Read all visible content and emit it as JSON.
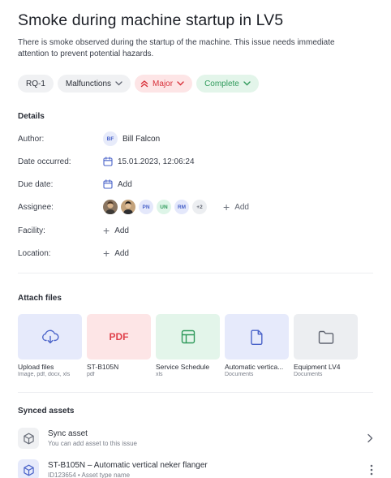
{
  "issue": {
    "title": "Smoke during machine startup in LV5",
    "description": "There is smoke observed during the startup of the machine. This issue needs immediate attention to prevent potential hazards."
  },
  "chips": {
    "id": "RQ-1",
    "category": "Malfunctions",
    "priority": "Major",
    "status": "Complete"
  },
  "colors": {
    "priority": "#d82f38",
    "status": "#2f9a5b",
    "accent": "#4a63c9"
  },
  "details": {
    "heading": "Details",
    "author_label": "Author:",
    "author_initials": "BF",
    "author_name": "Bill Falcon",
    "date_occurred_label": "Date occurred:",
    "date_occurred_value": "15.01.2023, 12:06:24",
    "due_date_label": "Due date:",
    "due_date_add": "Add",
    "assignee_label": "Assignee:",
    "assignees": [
      "PN",
      "UN",
      "RM"
    ],
    "assignees_more": "+2",
    "assignee_add": "Add",
    "facility_label": "Facility:",
    "facility_add": "Add",
    "location_label": "Location:",
    "location_add": "Add"
  },
  "attach": {
    "heading": "Attach files",
    "files": [
      {
        "name": "Upload files",
        "sub": "Image, pdf, docx, xls",
        "icon": "cloud-upload-icon"
      },
      {
        "name": "ST-B105N",
        "sub": "pdf",
        "tile_text": "PDF"
      },
      {
        "name": "Service Schedule",
        "sub": "xls",
        "icon": "table-icon"
      },
      {
        "name": "Automatic vertica...",
        "sub": "Documents",
        "icon": "document-icon"
      },
      {
        "name": "Equipment LV4",
        "sub": "Documents",
        "icon": "folder-icon"
      }
    ]
  },
  "synced": {
    "heading": "Synced assets",
    "sync_title": "Sync asset",
    "sync_sub": "You can add asset to this issue",
    "asset_title": "ST-B105N – Automatic vertical neker flanger",
    "asset_sub": "ID123654 • Asset type name"
  }
}
